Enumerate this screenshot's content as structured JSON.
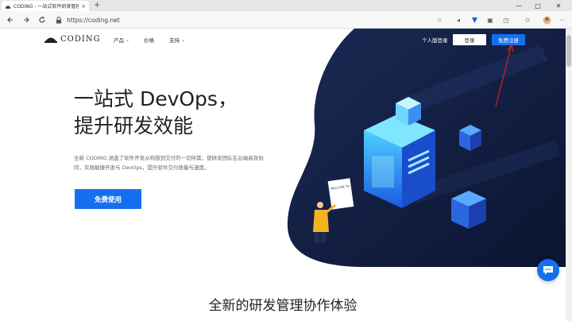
{
  "browser": {
    "tab_title": "CODING - 一站式软件研发管理平",
    "tab_close": "×",
    "new_tab": "+",
    "window_controls": [
      "—",
      "□",
      "✕"
    ],
    "url": "https://coding.net"
  },
  "nav": {
    "logo_text": "CODING",
    "items": [
      {
        "label": "产品",
        "has_chevron": true
      },
      {
        "label": "价格",
        "has_chevron": false
      },
      {
        "label": "支持",
        "has_chevron": true
      }
    ],
    "chevron": "⌄",
    "personal_login": "个人版登录",
    "login": "登录",
    "signup": "免费注册"
  },
  "hero": {
    "headline_line1": "一站式 DevOps，",
    "headline_line2": "提升研发效能",
    "description": "全新 CODING 涵盖了软件开发从构想到交付的一切所需，使研发团队在云端高效协同，实践敏捷开发与 DevOps，提升软件交付质量与速度。",
    "cta": "免费使用",
    "illustration_sign": "WELCOME TO"
  },
  "section": {
    "title": "全新的研发管理协作体验"
  },
  "colors": {
    "brand_blue": "#1570ef",
    "hero_dark": "#0f1a3a",
    "annotation_red": "#d0201e"
  }
}
